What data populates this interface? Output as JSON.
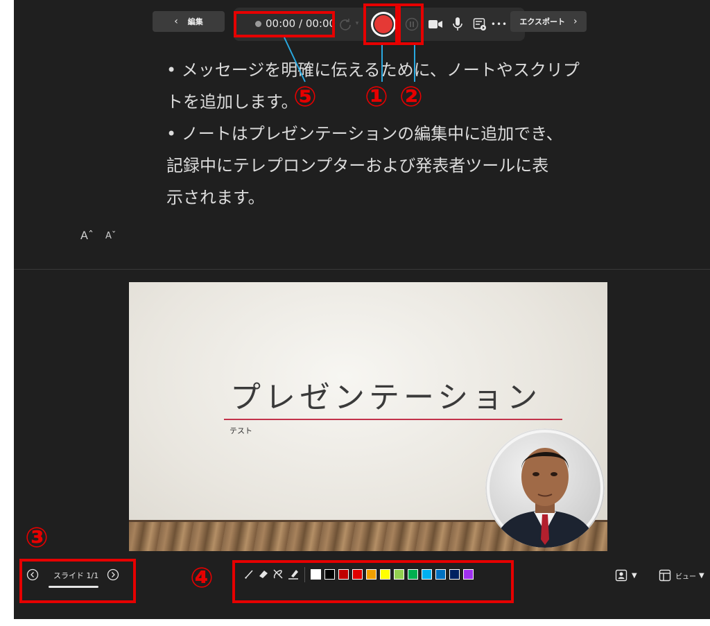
{
  "toolbar": {
    "back_label": "編集",
    "timer": "00:00 / 00:00",
    "export_label": "エクスポート",
    "more_label": "•••"
  },
  "notes": {
    "paragraphs": [
      "• メッセージを明確に伝えるために、ノートやスクリプ",
      "トを追加します。",
      "• ノートはプレゼンテーションの編集中に追加でき、",
      "記録中にテレプロンプターおよび発表者ツールに表",
      "示されます。"
    ],
    "font_increase": "Aˆ",
    "font_decrease": "Aˇ"
  },
  "slide": {
    "title": "プレゼンテーション",
    "subtitle": "テスト"
  },
  "navigation": {
    "slide_counter": "スライド 1/1"
  },
  "view": {
    "view_label": "ビュー"
  },
  "colors": {
    "accent": "#e60000",
    "record": "#e53935",
    "palette": [
      "#ffffff",
      "#000000",
      "#c00000",
      "#e00000",
      "#f0a000",
      "#ffff00",
      "#92d050",
      "#00b050",
      "#00b0f0",
      "#0070c0",
      "#002060",
      "#a030f0"
    ]
  },
  "annotations": {
    "badge_1": "①",
    "badge_2": "②",
    "badge_3": "③",
    "badge_4": "④",
    "badge_5": "⑤"
  }
}
